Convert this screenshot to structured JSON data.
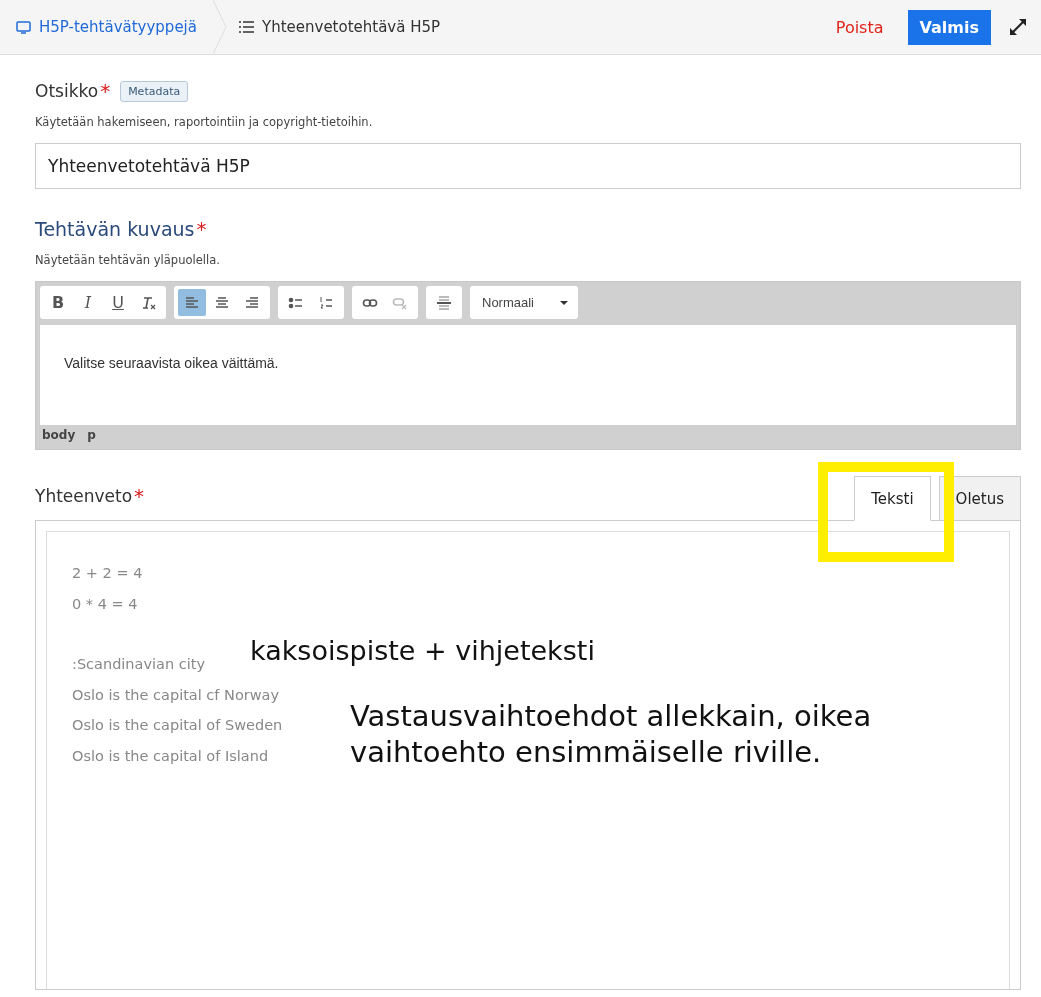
{
  "header": {
    "breadcrumbs": [
      {
        "label": "H5P-tehtävätyyppejä",
        "kind": "link"
      },
      {
        "label": "Yhteenvetotehtävä H5P",
        "kind": "current"
      }
    ],
    "delete_label": "Poista",
    "done_label": "Valmis"
  },
  "title_field": {
    "label": "Otsikko",
    "required": true,
    "metadata_label": "Metadata",
    "description": "Käytetään hakemiseen, raportointiin ja copyright-tietoihin.",
    "value": "Yhteenvetotehtävä H5P"
  },
  "description_field": {
    "label": "Tehtävän kuvaus",
    "required": true,
    "description": "Näytetään tehtävän yläpuolella.",
    "toolbar": [
      [
        {
          "kind": "bold",
          "label": "B",
          "selected": false,
          "disabled": false
        },
        {
          "kind": "italic",
          "label": "I",
          "selected": false,
          "disabled": false
        },
        {
          "kind": "underline",
          "label": "U",
          "selected": false,
          "disabled": false
        },
        {
          "kind": "clear",
          "selected": false,
          "disabled": false
        }
      ],
      [
        {
          "kind": "align-left",
          "selected": true,
          "disabled": false
        },
        {
          "kind": "align-center",
          "selected": false,
          "disabled": false
        },
        {
          "kind": "align-right",
          "selected": false,
          "disabled": false
        }
      ],
      [
        {
          "kind": "bullets",
          "selected": false,
          "disabled": false
        },
        {
          "kind": "numbers",
          "selected": false,
          "disabled": false
        }
      ],
      [
        {
          "kind": "link",
          "selected": false,
          "disabled": false
        },
        {
          "kind": "unlink",
          "selected": false,
          "disabled": true
        }
      ],
      [
        {
          "kind": "rule",
          "selected": false,
          "disabled": false
        }
      ]
    ],
    "format_label": "Normaali",
    "content": "Valitse seuraavista oikea väittämä.",
    "path": [
      "body",
      "p"
    ]
  },
  "summary_field": {
    "label": "Yhteenveto",
    "required": true,
    "tabs": [
      {
        "label": "Teksti",
        "selected": true
      },
      {
        "label": "Oletus",
        "selected": false
      }
    ],
    "paragraphs": [
      [
        "2 + 2 = 4",
        "0 * 4 = 4"
      ],
      [
        ":Scandinavian city",
        "Oslo is the capital cf Norway",
        "Oslo is the capital of Sweden",
        "Oslo is the capital of Island"
      ]
    ]
  },
  "required_mark": "*",
  "annotations": [
    "kaksoispiste + vihjeteksti",
    "Vastausvaihtoehdot allekkain, oikea vaihtoehto ensimmäiselle riville."
  ]
}
